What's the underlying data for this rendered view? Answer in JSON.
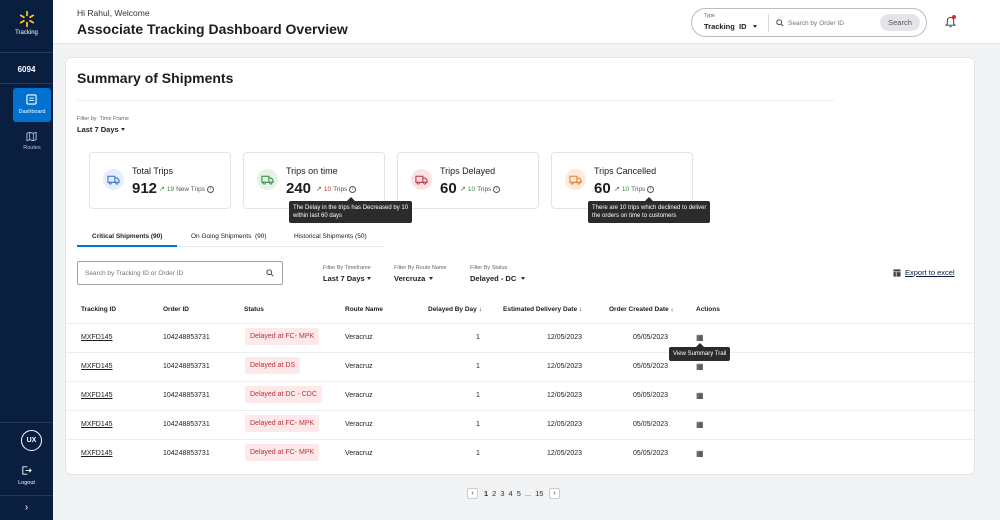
{
  "sidebar": {
    "brand": "Tracking",
    "user_id": "6094",
    "items": [
      {
        "label": "Dashboard",
        "icon": "dashboard-icon"
      },
      {
        "label": "Routes",
        "icon": "map-icon"
      }
    ],
    "avatar": "UX",
    "logout": "Logout",
    "expand": "›"
  },
  "header": {
    "greeting": "Hi Rahul, Welcome",
    "title": "Associate Tracking Dashboard Overview",
    "type_label": "Type",
    "type_value": "Tracking  ID",
    "search_placeholder": "Search by Order ID",
    "search_button": "Search"
  },
  "summary": {
    "title": "Summary of Shipments",
    "filter_label": "Filter by  Time Frame",
    "filter_value": "Last 7 Days"
  },
  "kpis": [
    {
      "title": "Total Trips",
      "value": "912",
      "change": "19",
      "unit": "New Trips",
      "color": "#2f6fd1",
      "bg": "#e6eefb"
    },
    {
      "title": "Trips on time",
      "value": "240",
      "change": "10",
      "unit": "Trips",
      "color": "#2e8b3d",
      "bg": "#e3f3e6"
    },
    {
      "title": "Trips Delayed",
      "value": "60",
      "change": "10",
      "unit": "Trips",
      "color": "#c0303b",
      "bg": "#fbe3e5"
    },
    {
      "title": "Trips Cancelled",
      "value": "60",
      "change": "10",
      "unit": "Trips",
      "color": "#e07b2b",
      "bg": "#fdeadb"
    }
  ],
  "tooltips": {
    "on_time": [
      "The Delay in the trips has Decreased by 10",
      "within last 60 days"
    ],
    "cancelled": [
      "There are 10 trips which declined to deliver",
      "the orders on time to customers"
    ],
    "summary_trail": "View Summary Trail"
  },
  "tabs": [
    {
      "label": "Critical Shipments (90)",
      "active": true
    },
    {
      "label": "On Going Shipments  (90)",
      "active": false
    },
    {
      "label": "Historical Shipments (50)",
      "active": false
    }
  ],
  "table_search_placeholder": "Search by Tracking ID or Order ID",
  "filters": [
    {
      "label": "Filter By Timeframe",
      "value": "Last 7 Days"
    },
    {
      "label": "Filter By Route Name",
      "value": "Vercruza"
    },
    {
      "label": "Filter By Status",
      "value": "Delayed - DC"
    }
  ],
  "export_label": "Export to excel",
  "table": {
    "headers": [
      "Tracking ID",
      "Order ID",
      "Status",
      "Route Name",
      "Delayed By Day",
      "Estimated Delivery Date",
      "Order Created Date",
      "Actions"
    ],
    "rows": [
      {
        "tracking": "MXFD145",
        "order": "104248853731",
        "status": "Delayed at FC- MPK",
        "route": "Veracruz",
        "delay": "1",
        "eta": "12/05/2023",
        "created": "05/05/2023"
      },
      {
        "tracking": "MXFD145",
        "order": "104248853731",
        "status": "Delayed at DS",
        "route": "Veracruz",
        "delay": "1",
        "eta": "12/05/2023",
        "created": "05/05/2023"
      },
      {
        "tracking": "MXFD145",
        "order": "104248853731",
        "status": "Delayed at DC - CDC",
        "route": "Veracruz",
        "delay": "1",
        "eta": "12/05/2023",
        "created": "05/05/2023"
      },
      {
        "tracking": "MXFD145",
        "order": "104248853731",
        "status": "Delayed at FC- MPK",
        "route": "Veracruz",
        "delay": "1",
        "eta": "12/05/2023",
        "created": "05/05/2023"
      },
      {
        "tracking": "MXFD145",
        "order": "104248853731",
        "status": "Delayed at FC- MPK",
        "route": "Veracruz",
        "delay": "1",
        "eta": "12/05/2023",
        "created": "05/05/2023"
      }
    ]
  },
  "pagination": {
    "pages": [
      "1",
      "2",
      "3",
      "4",
      "5",
      "...",
      "15"
    ],
    "prev": "‹",
    "next": "›"
  }
}
